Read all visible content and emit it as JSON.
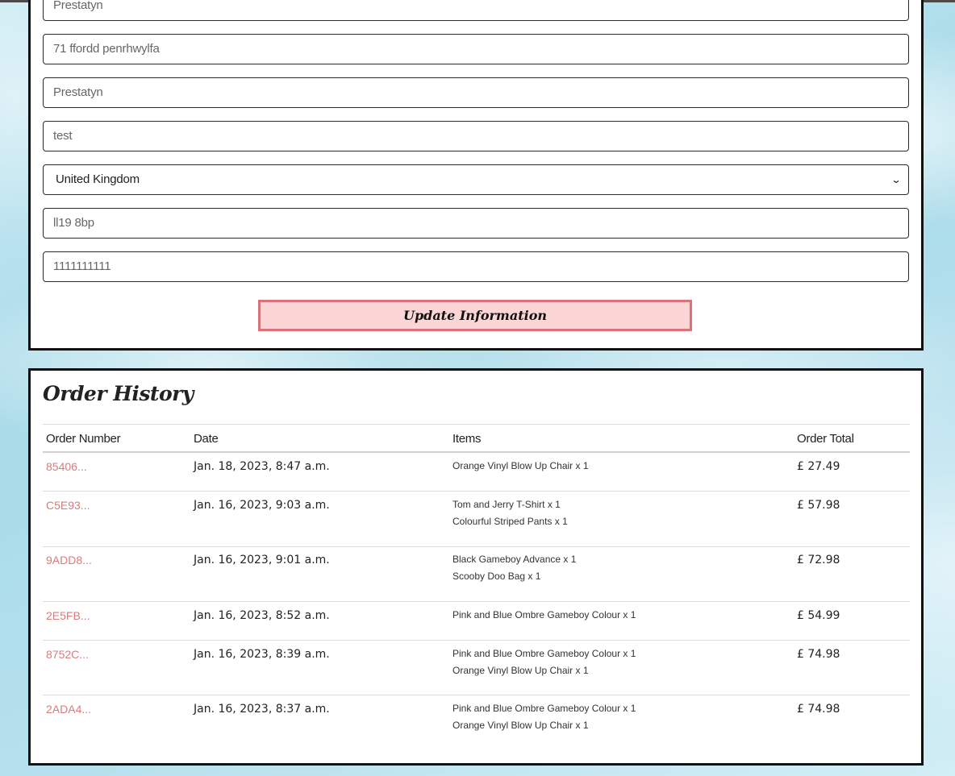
{
  "profile_form": {
    "fields": [
      {
        "value": "Prestatyn"
      },
      {
        "value": "71 ffordd penrhwylfa"
      },
      {
        "value": "Prestatyn"
      },
      {
        "value": "test"
      },
      {
        "value": "United Kingdom",
        "type": "select"
      },
      {
        "value": "ll19 8bp"
      },
      {
        "value": "1111111111"
      }
    ],
    "submit_label": "Update Information"
  },
  "order_history": {
    "title": "Order History",
    "columns": [
      "Order Number",
      "Date",
      "Items",
      "Order Total"
    ],
    "rows": [
      {
        "order_number": "85406...",
        "date": "Jan. 18, 2023, 8:47 a.m.",
        "items": [
          "Orange Vinyl Blow Up Chair x 1"
        ],
        "total": "£ 27.49"
      },
      {
        "order_number": "C5E93...",
        "date": "Jan. 16, 2023, 9:03 a.m.",
        "items": [
          "Tom and Jerry T-Shirt x 1",
          "Colourful Striped Pants x 1"
        ],
        "total": "£ 57.98"
      },
      {
        "order_number": "9ADD8...",
        "date": "Jan. 16, 2023, 9:01 a.m.",
        "items": [
          "Black Gameboy Advance x 1",
          "Scooby Doo Bag x 1"
        ],
        "total": "£ 72.98"
      },
      {
        "order_number": "2E5FB...",
        "date": "Jan. 16, 2023, 8:52 a.m.",
        "items": [
          "Pink and Blue Ombre Gameboy Colour x 1"
        ],
        "total": "£ 54.99"
      },
      {
        "order_number": "8752C...",
        "date": "Jan. 16, 2023, 8:39 a.m.",
        "items": [
          "Pink and Blue Ombre Gameboy Colour x 1",
          "Orange Vinyl Blow Up Chair x 1"
        ],
        "total": "£ 74.98"
      },
      {
        "order_number": "2ADA4...",
        "date": "Jan. 16, 2023, 8:37 a.m.",
        "items": [
          "Pink and Blue Ombre Gameboy Colour x 1",
          "Orange Vinyl Blow Up Chair x 1"
        ],
        "total": "£ 74.98"
      }
    ]
  },
  "colors": {
    "link": "#d97c7c",
    "button_bg": "#fcd6d6",
    "button_border": "#d9727a"
  }
}
